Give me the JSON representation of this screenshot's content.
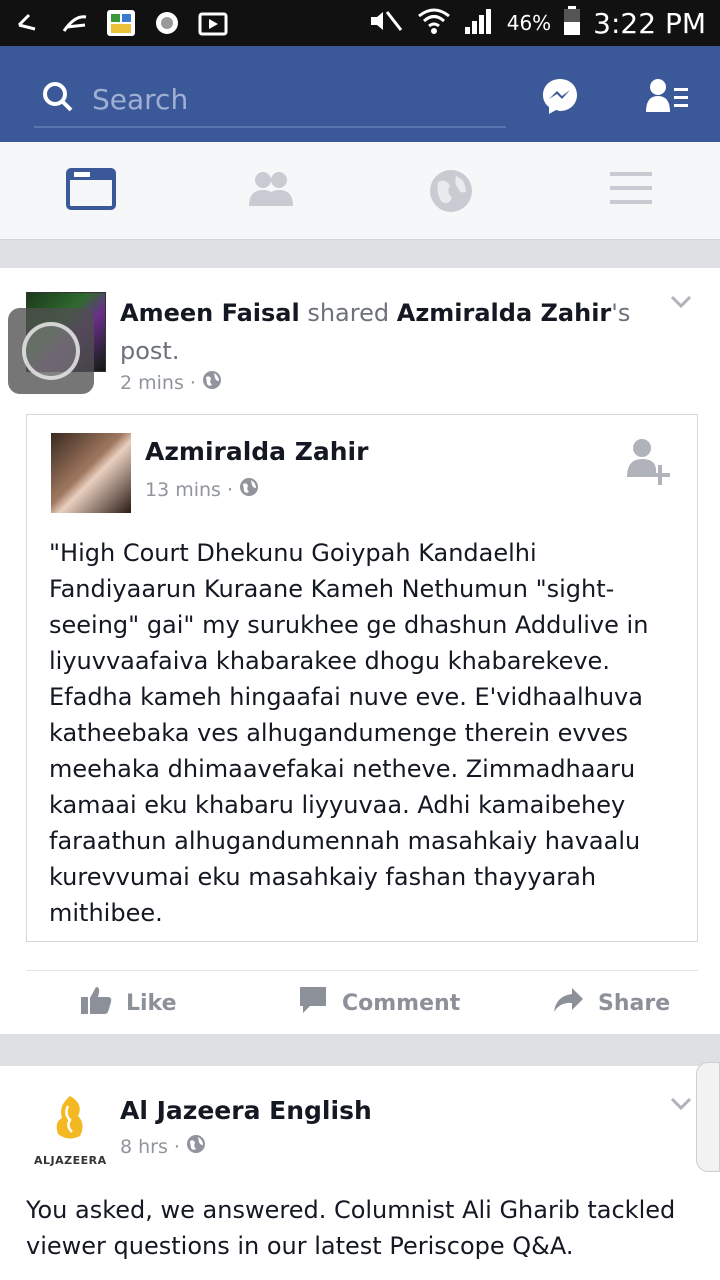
{
  "status_bar": {
    "battery": "46%",
    "time": "3:22 PM"
  },
  "search": {
    "placeholder": "Search"
  },
  "post1": {
    "author": "Ameen Faisal",
    "action_word": "shared",
    "shared_name": "Azmiralda Zahir",
    "possessive": "'s",
    "post_word": "post.",
    "time": "2 mins",
    "shared": {
      "author": "Azmiralda Zahir",
      "time": "13 mins",
      "text": "\"High Court Dhekunu Goiypah Kandaelhi Fandiyaarun Kuraane Kameh Nethumun \"sight-seeing\" gai\" my surukhee ge dhashun Addulive in liyuvvaafaiva khabarakee dhogu khabarekeve. Efadha kameh hingaafai nuve eve. E'vidhaalhuva katheebaka ves alhugandumenge therein evves meehaka dhimaavefakai netheve. Zimmadhaaru kamaai eku khabaru liyyuvaa. Adhi kamaibehey faraathun alhugandumennah masahkaiy havaalu kurevvumai eku masahkaiy fashan thayyarah mithibee."
    },
    "actions": {
      "like": "Like",
      "comment": "Comment",
      "share": "Share"
    }
  },
  "post2": {
    "author": "Al Jazeera English",
    "logo_text": "ALJAZEERA",
    "time": "8 hrs",
    "text": "You asked, we answered. Columnist Ali Gharib tackled viewer questions in our latest Periscope Q&A."
  },
  "colors": {
    "brand": "#3b5998",
    "active_tab": "#3b5998",
    "inactive_tab": "#c8cbd1"
  }
}
